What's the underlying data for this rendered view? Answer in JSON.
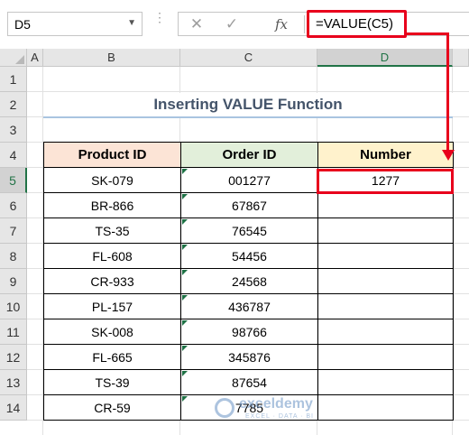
{
  "formula_bar": {
    "name_box": "D5",
    "formula": "=VALUE(C5)",
    "cancel_icon": "close-icon",
    "enter_icon": "check-icon",
    "fx_label": "fx"
  },
  "columns": [
    "A",
    "B",
    "C",
    "D"
  ],
  "rows": [
    "1",
    "2",
    "3",
    "4",
    "5",
    "6",
    "7",
    "8",
    "9",
    "10",
    "11",
    "12",
    "13",
    "14"
  ],
  "active_cell": "D5",
  "sheet": {
    "title": "Inserting VALUE Function",
    "headers": [
      "Product ID",
      "Order ID",
      "Number"
    ],
    "data": [
      {
        "product_id": "SK-079",
        "order_id": "001277",
        "number": "1277"
      },
      {
        "product_id": "BR-866",
        "order_id": "67867",
        "number": ""
      },
      {
        "product_id": "TS-35",
        "order_id": "76545",
        "number": ""
      },
      {
        "product_id": "FL-608",
        "order_id": "54456",
        "number": ""
      },
      {
        "product_id": "CR-933",
        "order_id": "24568",
        "number": ""
      },
      {
        "product_id": "PL-157",
        "order_id": "436787",
        "number": ""
      },
      {
        "product_id": "SK-008",
        "order_id": "98766",
        "number": ""
      },
      {
        "product_id": "FL-665",
        "order_id": "345876",
        "number": ""
      },
      {
        "product_id": "TS-39",
        "order_id": "87654",
        "number": ""
      },
      {
        "product_id": "CR-59",
        "order_id": "7785",
        "number": ""
      }
    ]
  },
  "watermark": {
    "name": "exceldemy",
    "sub": "EXCEL · DATA · BI"
  },
  "colors": {
    "highlight": "#e8001c",
    "excel_green": "#217346",
    "header_b": "#fce4d6",
    "header_c": "#e2efda",
    "header_d": "#fff2cc",
    "title_text": "#44546a"
  }
}
